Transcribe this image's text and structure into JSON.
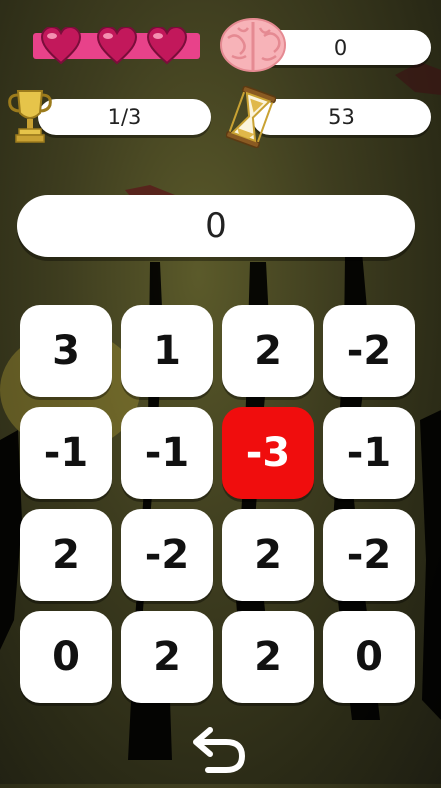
{
  "hud": {
    "lives": 3,
    "score": "0",
    "progress": "1/3",
    "timer": "53",
    "icons": [
      "heart-icon",
      "brain-icon",
      "trophy-icon",
      "hourglass-icon"
    ]
  },
  "answer": {
    "value": "0"
  },
  "board": {
    "tiles": [
      "3",
      "1",
      "2",
      "-2",
      "-1",
      "-1",
      "-3",
      "-1",
      "2",
      "-2",
      "2",
      "-2",
      "0",
      "2",
      "2",
      "0"
    ],
    "selected_index": 6,
    "selected_color": "#f00d0d"
  },
  "controls": {
    "undo_icon": "undo-icon"
  }
}
